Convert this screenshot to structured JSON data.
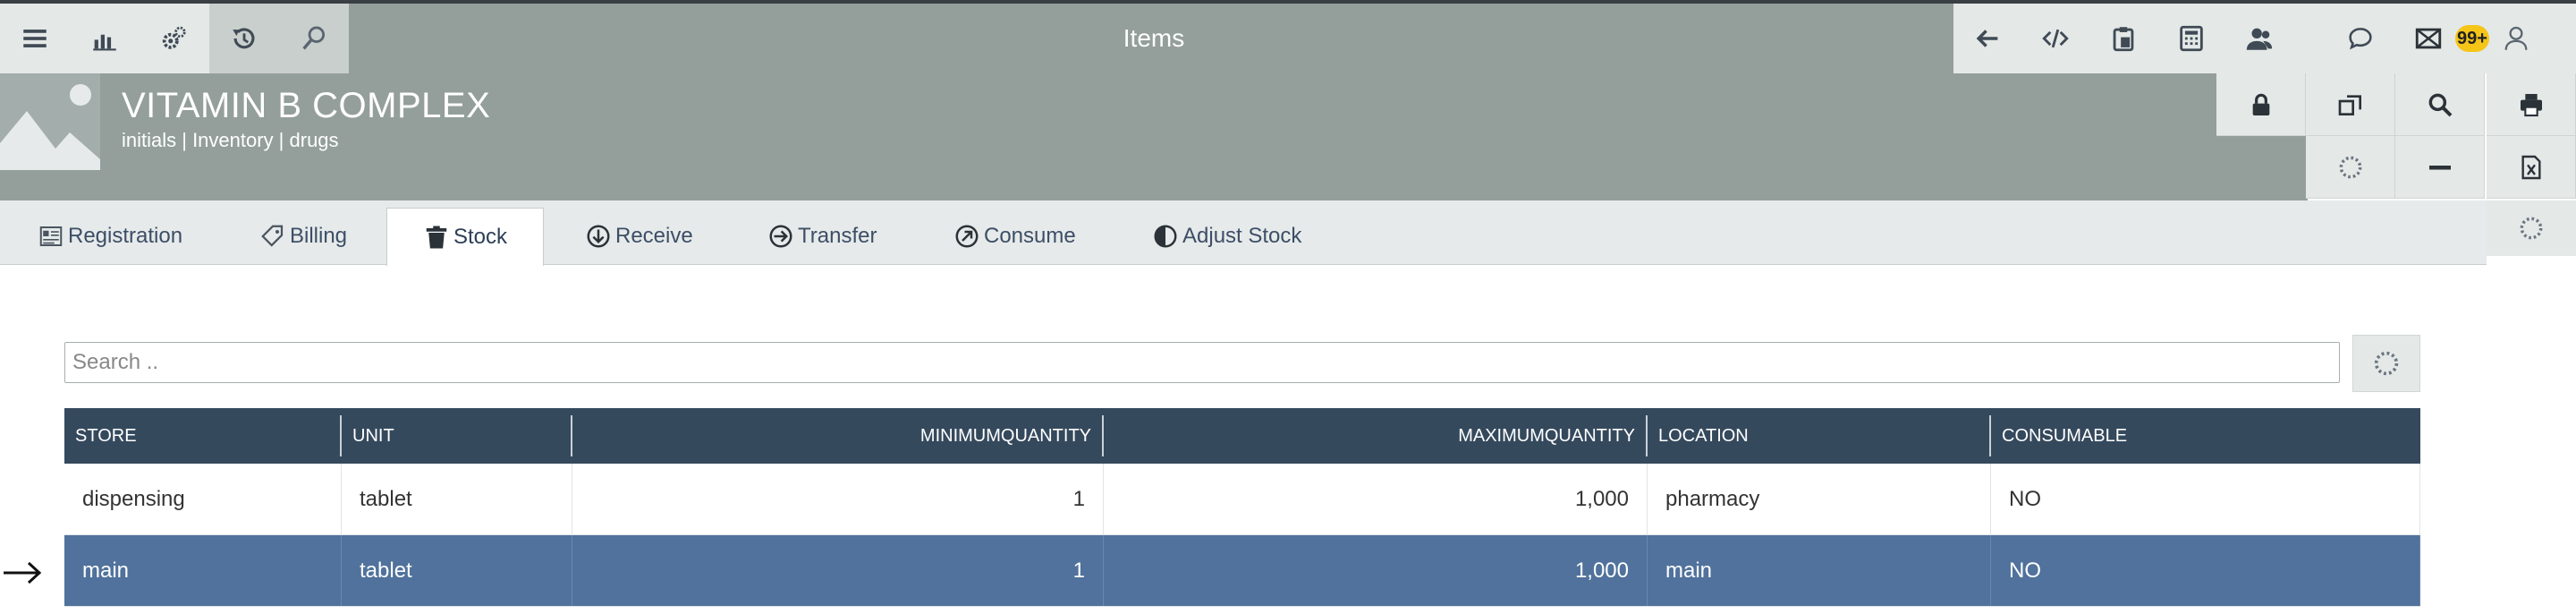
{
  "window": {
    "title": "Items",
    "notifications": "99+"
  },
  "item": {
    "name": "VITAMIN B COMPLEX",
    "breadcrumb": "initials | Inventory | drugs"
  },
  "tabs": [
    {
      "label": "Registration",
      "icon": "registration-icon"
    },
    {
      "label": "Billing",
      "icon": "tag-icon"
    },
    {
      "label": "Stock",
      "icon": "trash-icon",
      "active": true
    },
    {
      "label": "Receive",
      "icon": "arrow-down-circle-icon"
    },
    {
      "label": "Transfer",
      "icon": "arrow-right-circle-icon"
    },
    {
      "label": "Consume",
      "icon": "arrow-upright-circle-icon"
    },
    {
      "label": "Adjust Stock",
      "icon": "half-circle-icon"
    }
  ],
  "search": {
    "placeholder": "Search .."
  },
  "table": {
    "columns": [
      "STORE",
      "UNIT",
      "MINIMUMQUANTITY",
      "MAXIMUMQUANTITY",
      "LOCATION",
      "CONSUMABLE"
    ],
    "rows": [
      {
        "store": "dispensing",
        "unit": "tablet",
        "min": "1",
        "max": "1,000",
        "location": "pharmacy",
        "consumable": "NO",
        "selected": false
      },
      {
        "store": "main",
        "unit": "tablet",
        "min": "1",
        "max": "1,000",
        "location": "main",
        "consumable": "NO",
        "selected": true
      }
    ]
  },
  "colors": {
    "header_bg": "#949f9c",
    "table_header": "#35495d",
    "selected_row": "#50729c",
    "badge": "#f5c518"
  }
}
